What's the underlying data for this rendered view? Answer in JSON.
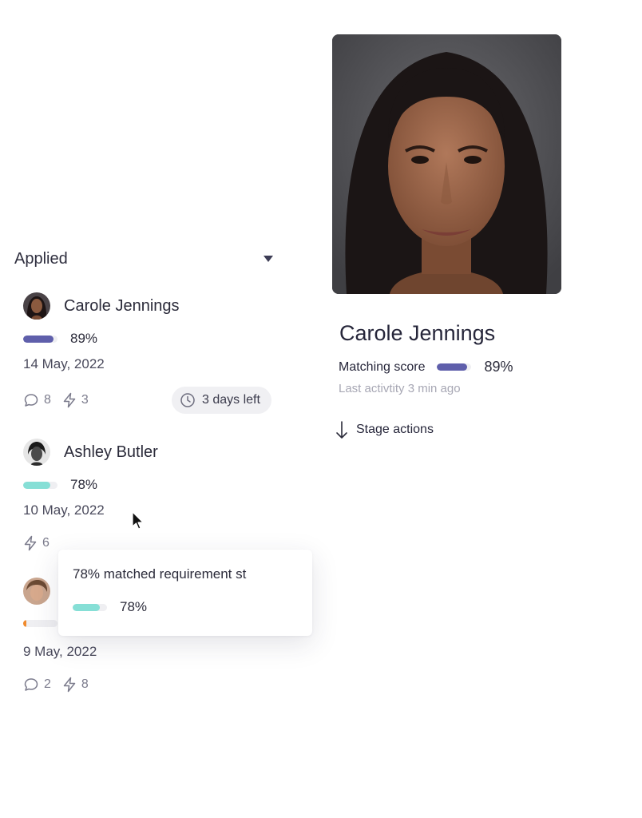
{
  "stage": {
    "title": "Applied"
  },
  "colors": {
    "purple": "#5f5fab",
    "teal": "#86dfd6",
    "orange": "#f08a2c"
  },
  "candidates": [
    {
      "name": "Carole Jennings",
      "score_pct": "89%",
      "score": 0.89,
      "bar_color": "#5f5fab",
      "date": "14 May, 2022",
      "comments": "8",
      "actions": "3",
      "time_left": "3 days left"
    },
    {
      "name": "Ashley Butler",
      "score_pct": "78%",
      "score": 0.78,
      "bar_color": "#86dfd6",
      "date": "10 May, 2022",
      "actions": "6"
    },
    {
      "score": 0.1,
      "bar_color": "#f08a2c",
      "date": "9 May, 2022",
      "comments": "2",
      "actions": "8"
    }
  ],
  "tooltip": {
    "text": "78% matched requirement st",
    "score_pct": "78%",
    "score": 0.78
  },
  "detail": {
    "name": "Carole Jennings",
    "matching_label": "Matching score",
    "score_pct": "89%",
    "score": 0.89,
    "last_activity": "Last activtity 3 min ago",
    "stage_actions_label": "Stage actions"
  }
}
